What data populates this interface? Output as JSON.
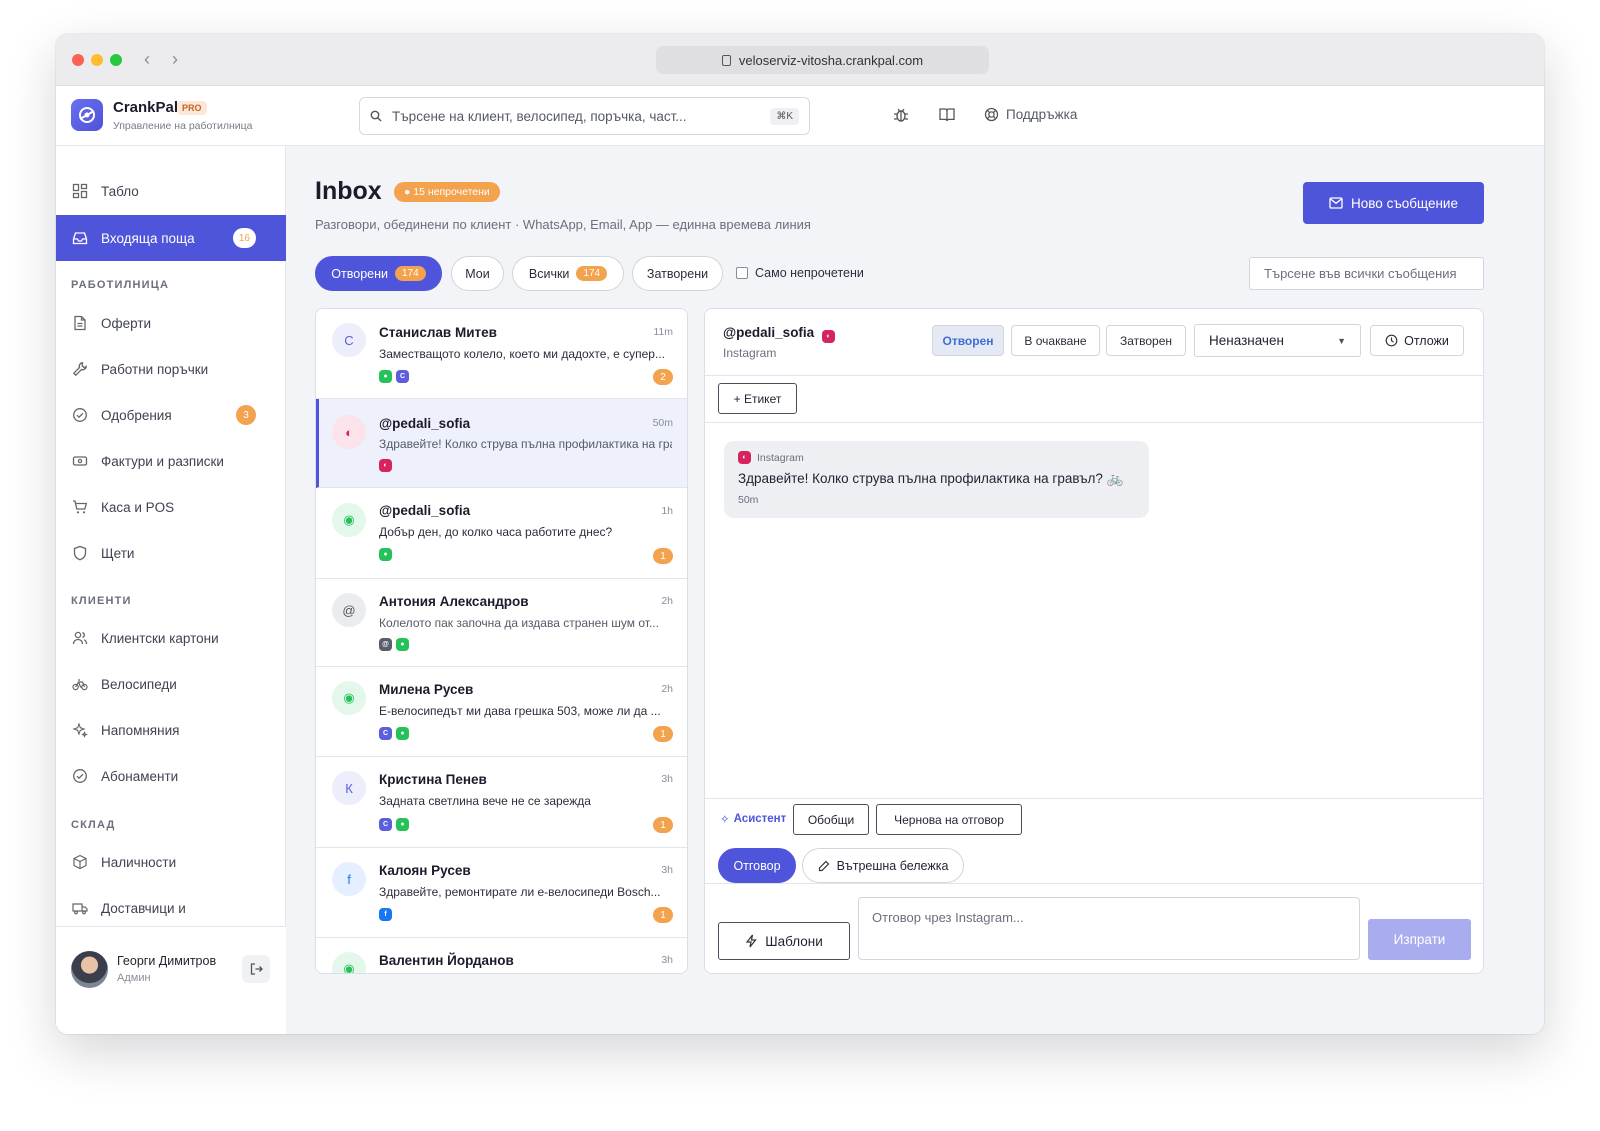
{
  "browser": {
    "url": "veloserviz-vitosha.crankpal.com"
  },
  "app": {
    "name": "CrankPal",
    "plan": "PRO",
    "subtitle": "Управление на работилница"
  },
  "topbar": {
    "search_placeholder": "Търсене на клиент, велосипед, поръчка, част...",
    "shortcut": "⌘K",
    "support_label": "Поддръжка"
  },
  "sidebar": {
    "items": [
      {
        "label": "Табло",
        "icon": "grid-icon"
      },
      {
        "label": "Входяща поща",
        "icon": "inbox-icon",
        "badge": "16",
        "active": true
      }
    ],
    "sections": [
      {
        "title": "РАБОТИЛНИЦА",
        "items": [
          {
            "label": "Оферти",
            "icon": "document-icon"
          },
          {
            "label": "Работни поръчки",
            "icon": "wrench-icon"
          },
          {
            "label": "Одобрения",
            "icon": "check-circle-icon",
            "badge": "3"
          },
          {
            "label": "Фактури и разписки",
            "icon": "receipt-icon"
          },
          {
            "label": "Каса и POS",
            "icon": "cart-icon"
          },
          {
            "label": "Щети",
            "icon": "shield-icon"
          }
        ]
      },
      {
        "title": "КЛИЕНТИ",
        "items": [
          {
            "label": "Клиентски картони",
            "icon": "users-icon"
          },
          {
            "label": "Велосипеди",
            "icon": "bicycle-icon"
          },
          {
            "label": "Напомняния",
            "icon": "sparkle-icon"
          },
          {
            "label": "Абонаменти",
            "icon": "check-circle-icon"
          }
        ]
      },
      {
        "title": "СКЛАД",
        "items": [
          {
            "label": "Наличности",
            "icon": "box-icon"
          },
          {
            "label": "Доставчици и",
            "icon": "truck-icon"
          }
        ]
      }
    ],
    "user": {
      "name": "Георги Димитров",
      "role": "Админ"
    }
  },
  "inbox": {
    "title": "Inbox",
    "unread_badge": "15 непрочетени",
    "subtitle": "Разговори, обединени по клиент · WhatsApp, Email, App — единна времева линия",
    "new_message": "Ново съобщение",
    "filters": [
      {
        "label": "Отворени",
        "count": "174",
        "active": true
      },
      {
        "label": "Мои"
      },
      {
        "label": "Всички",
        "count": "174"
      },
      {
        "label": "Затворени"
      }
    ],
    "unread_only": "Само непрочетени",
    "search_all_placeholder": "Търсене във всички съобщения"
  },
  "conversations": [
    {
      "initial": "С",
      "name": "Станислав Митев",
      "time": "11m",
      "preview": "Заместващото колело, което ми дадохте, е супер...",
      "channels": [
        "whatsapp",
        "app"
      ],
      "unread": "2"
    },
    {
      "initial": "◐",
      "name": "@pedali_sofia",
      "time": "50m",
      "preview": "Здравейте! Колко струва пълна профилактика на гравъл? 🚲",
      "channels": [
        "instagram"
      ],
      "selected": true
    },
    {
      "initial": "◉",
      "name": "@pedali_sofia",
      "time": "1h",
      "preview": "Добър ден, до колко часа работите днес?",
      "channels": [
        "whatsapp"
      ],
      "unread": "1"
    },
    {
      "initial": "@",
      "name": "Антония Александров",
      "time": "2h",
      "preview": "Колелото пак започна да издава странен шум от...",
      "channels": [
        "email",
        "whatsapp"
      ]
    },
    {
      "initial": "◉",
      "name": "Милена Русев",
      "time": "2h",
      "preview": "Е-велосипедът ми дава грешка 503, може ли да ...",
      "channels": [
        "app",
        "whatsapp"
      ],
      "unread": "1"
    },
    {
      "initial": "К",
      "name": "Кристина Пенев",
      "time": "3h",
      "preview": "Задната светлина вече не се зарежда",
      "channels": [
        "app",
        "whatsapp"
      ],
      "unread": "1"
    },
    {
      "initial": "f",
      "name": "Калоян Русев",
      "time": "3h",
      "preview": "Здравейте, ремонтирате ли е-велосипеди Bosch...",
      "channels": [
        "facebook"
      ],
      "unread": "1"
    },
    {
      "initial": "◉",
      "name": "Валентин Йорданов",
      "time": "3h",
      "preview": "",
      "channels": []
    }
  ],
  "detail": {
    "name": "@pedali_sofia",
    "channel": "Instagram",
    "statuses": [
      "Отворен",
      "В очакване",
      "Затворен"
    ],
    "assignee": "Неназначен",
    "snooze": "Отложи",
    "tag_button": "+ Етикет",
    "message": {
      "source": "Instagram",
      "text": "Здравейте! Колко струва пълна профилактика на гравъл? 🚲",
      "time": "50m"
    },
    "assistant_label": "Асистент",
    "summarize": "Обобщи",
    "draft_reply": "Чернова на отговор",
    "reply_tab": "Отговор",
    "note_tab": "Вътрешна бележка",
    "templates": "Шаблони",
    "reply_placeholder": "Отговор чрез Instagram...",
    "send": "Изпрати"
  },
  "colors": {
    "accent": "#4f55db",
    "badge": "#f3a24e",
    "instagram": "#d6245e",
    "whatsapp": "#25c25a",
    "app": "#5b5fdc",
    "facebook": "#1877f2",
    "email": "#5a5d6a"
  }
}
